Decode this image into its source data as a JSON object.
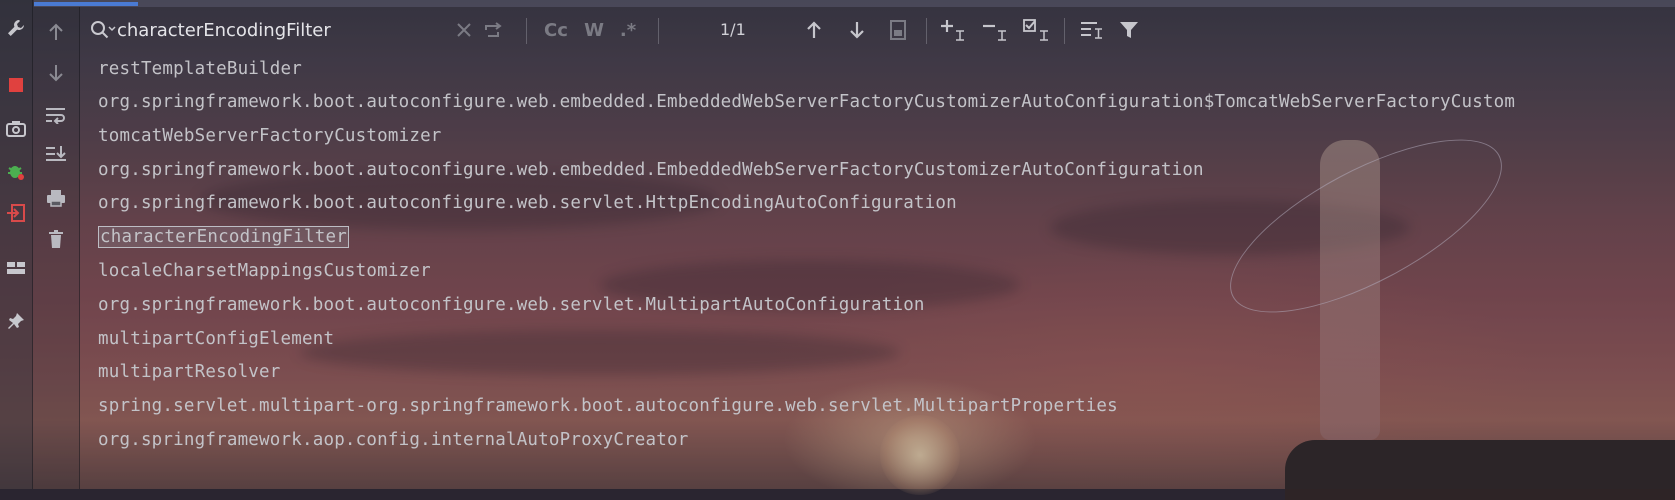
{
  "search": {
    "query": "characterEncodingFilter",
    "match_count": "1/1",
    "case_label": "Cc",
    "words_label": "W",
    "regex_label": ".*"
  },
  "console": {
    "lines": [
      "restTemplateBuilder",
      "org.springframework.boot.autoconfigure.web.embedded.EmbeddedWebServerFactoryCustomizerAutoConfiguration$TomcatWebServerFactoryCustom",
      "tomcatWebServerFactoryCustomizer",
      "org.springframework.boot.autoconfigure.web.embedded.EmbeddedWebServerFactoryCustomizerAutoConfiguration",
      "org.springframework.boot.autoconfigure.web.servlet.HttpEncodingAutoConfiguration",
      "characterEncodingFilter",
      "localeCharsetMappingsCustomizer",
      "org.springframework.boot.autoconfigure.web.servlet.MultipartAutoConfiguration",
      "multipartConfigElement",
      "multipartResolver",
      "spring.servlet.multipart-org.springframework.boot.autoconfigure.web.servlet.MultipartProperties",
      "org.springframework.aop.config.internalAutoProxyCreator"
    ],
    "highlighted_index": 5
  },
  "icons": {
    "left_strip": [
      "wrench-icon",
      "stop-icon",
      "camera-icon",
      "debug-bug-icon",
      "exit-icon",
      "layout-icon",
      "pin-icon"
    ],
    "console_strip": [
      "up-arrow-icon",
      "down-arrow-icon",
      "soft-wrap-icon",
      "scroll-to-end-icon",
      "print-icon",
      "trash-icon"
    ],
    "toolbar": [
      "clear-icon",
      "replace-icon",
      "prev-occurrence-icon",
      "next-occurrence-icon",
      "open-in-window-icon",
      "add-selection-icon",
      "remove-selection-icon",
      "select-all-icon",
      "filter-lines-icon",
      "filter-icon"
    ]
  },
  "colors": {
    "accent": "#4a7bd3",
    "stop_red": "#e0413f",
    "debug_green": "#4caf50",
    "exit_red": "#d94a4a"
  }
}
